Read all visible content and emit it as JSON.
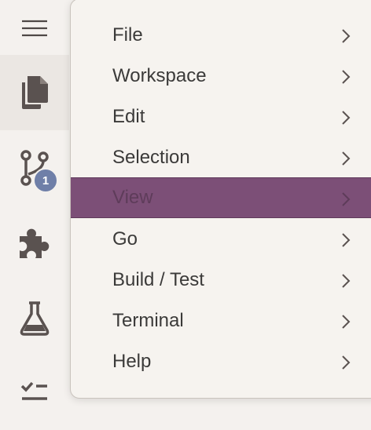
{
  "activity_bar": {
    "menu_icon": "hamburger-menu-icon",
    "items": [
      {
        "icon": "explorer-files-icon",
        "active": true
      },
      {
        "icon": "source-control-icon",
        "badge": "1"
      },
      {
        "icon": "extensions-icon"
      },
      {
        "icon": "testing-flask-icon"
      },
      {
        "icon": "checklist-icon"
      }
    ]
  },
  "menu": {
    "items": [
      {
        "label": "File",
        "submenu": true
      },
      {
        "label": "Workspace",
        "submenu": true
      },
      {
        "label": "Edit",
        "submenu": true
      },
      {
        "label": "Selection",
        "submenu": true
      },
      {
        "label": "View",
        "submenu": true,
        "highlighted": true
      },
      {
        "label": "Go",
        "submenu": true
      },
      {
        "label": "Build / Test",
        "submenu": true
      },
      {
        "label": "Terminal",
        "submenu": true
      },
      {
        "label": "Help",
        "submenu": true
      }
    ]
  },
  "colors": {
    "background": "#f4f1ee",
    "highlight": "#7c4f77",
    "badge": "#6f7fa8",
    "icon": "#5a5250"
  }
}
